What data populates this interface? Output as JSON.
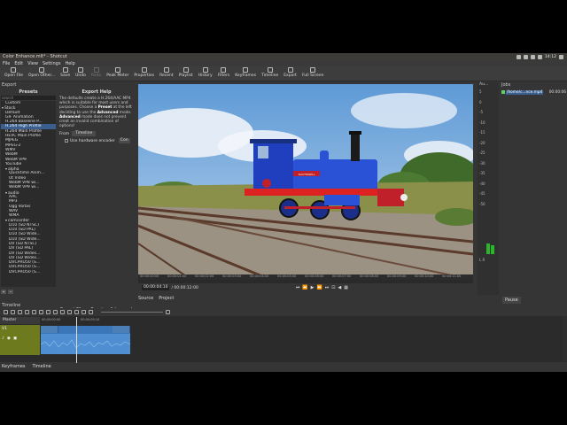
{
  "window": {
    "title": "Color Enhance.mlt* - Shotcut",
    "clock": "14:12"
  },
  "menu": [
    "File",
    "Edit",
    "View",
    "Settings",
    "Help"
  ],
  "toolbar": [
    {
      "label": "Open File",
      "icon": "folder-icon",
      "enabled": true
    },
    {
      "label": "Open Other...",
      "icon": "open-other-icon",
      "enabled": true
    },
    {
      "label": "Save",
      "icon": "save-icon",
      "enabled": true
    },
    {
      "label": "Undo",
      "icon": "undo-icon",
      "enabled": true
    },
    {
      "label": "Redo",
      "icon": "redo-icon",
      "enabled": false
    },
    {
      "label": "Peak Meter",
      "icon": "peak-meter-icon",
      "enabled": true
    },
    {
      "label": "Properties",
      "icon": "properties-icon",
      "enabled": true
    },
    {
      "label": "Recent",
      "icon": "recent-icon",
      "enabled": true
    },
    {
      "label": "Playlist",
      "icon": "playlist-icon",
      "enabled": true
    },
    {
      "label": "History",
      "icon": "history-icon",
      "enabled": true
    },
    {
      "label": "Filters",
      "icon": "filters-icon",
      "enabled": true
    },
    {
      "label": "Keyframes",
      "icon": "keyframes-icon",
      "enabled": true
    },
    {
      "label": "Timeline",
      "icon": "timeline-icon",
      "enabled": true
    },
    {
      "label": "Export",
      "icon": "export-icon",
      "enabled": true
    },
    {
      "label": "Full Screen",
      "icon": "fullscreen-icon",
      "enabled": true
    }
  ],
  "export": {
    "dock_title": "Export",
    "presets_header": "Presets",
    "search_placeholder": "search",
    "help_header": "Export Help",
    "help_text_1": "The defaults create a H.264/AAC MP4 which is suitable for most users and purposes. Choose a ",
    "help_bold_1": "Preset",
    "help_text_2": " at the left deciding to use the ",
    "help_bold_2": "Advanced",
    "help_text_3": " mode. ",
    "help_bold_3": "Advanced",
    "help_text_4": " mode does not prevent creat an invalid combination of options!",
    "from_label": "From",
    "from_value": "Timeline",
    "hw_label": "Use hardware encoder",
    "hw_config": "Con",
    "buttons": [
      "Export File",
      "Reset",
      "Advanced"
    ],
    "tree": [
      {
        "label": "Custom",
        "indent": 1,
        "cat": false
      },
      {
        "label": "Stock",
        "indent": 0,
        "cat": true
      },
      {
        "label": "Default",
        "indent": 1,
        "cat": false
      },
      {
        "label": "GIF Animation",
        "indent": 1,
        "cat": false
      },
      {
        "label": "H.264 Baseline P...",
        "indent": 1,
        "cat": false
      },
      {
        "label": "H.264 High Profile",
        "indent": 1,
        "cat": false,
        "selected": true
      },
      {
        "label": "H.264 Main Profile",
        "indent": 1,
        "cat": false
      },
      {
        "label": "HEVC Main Profile",
        "indent": 1,
        "cat": false
      },
      {
        "label": "MJPEG",
        "indent": 1,
        "cat": false
      },
      {
        "label": "MPEG-2",
        "indent": 1,
        "cat": false
      },
      {
        "label": "WMV",
        "indent": 1,
        "cat": false
      },
      {
        "label": "WebM",
        "indent": 1,
        "cat": false
      },
      {
        "label": "WebM VP9",
        "indent": 1,
        "cat": false
      },
      {
        "label": "YouTube",
        "indent": 1,
        "cat": false
      },
      {
        "label": "alpha",
        "indent": 1,
        "cat": true
      },
      {
        "label": "Quicktime Anim...",
        "indent": 2,
        "cat": false
      },
      {
        "label": "Ut Video",
        "indent": 2,
        "cat": false
      },
      {
        "label": "WebM VP8 wi...",
        "indent": 2,
        "cat": false
      },
      {
        "label": "WebM VP9 wi...",
        "indent": 2,
        "cat": false
      },
      {
        "label": "audio",
        "indent": 1,
        "cat": true
      },
      {
        "label": "AAC",
        "indent": 2,
        "cat": false
      },
      {
        "label": "MP3",
        "indent": 2,
        "cat": false
      },
      {
        "label": "Ogg Vorbis",
        "indent": 2,
        "cat": false
      },
      {
        "label": "WAV",
        "indent": 2,
        "cat": false
      },
      {
        "label": "WMA",
        "indent": 2,
        "cat": false
      },
      {
        "label": "camcorder",
        "indent": 1,
        "cat": true
      },
      {
        "label": "D10 (SD NTSC)",
        "indent": 2,
        "cat": false
      },
      {
        "label": "D10 (SD PAL)",
        "indent": 2,
        "cat": false
      },
      {
        "label": "D10 (SD Wide...",
        "indent": 2,
        "cat": false
      },
      {
        "label": "D10 (SD Wide...",
        "indent": 2,
        "cat": false
      },
      {
        "label": "DV (SD NTSC)",
        "indent": 2,
        "cat": false
      },
      {
        "label": "DV (SD PAL)",
        "indent": 2,
        "cat": false
      },
      {
        "label": "DV (SD Wides...",
        "indent": 2,
        "cat": false
      },
      {
        "label": "DV (SD Wides...",
        "indent": 2,
        "cat": false
      },
      {
        "label": "DVCPRO50 (S...",
        "indent": 2,
        "cat": false
      },
      {
        "label": "DVCPRO50 (S...",
        "indent": 2,
        "cat": false
      },
      {
        "label": "DVCPRO50 (S...",
        "indent": 2,
        "cat": false
      }
    ]
  },
  "left_tabs": [
    "Properties",
    "Playlist",
    "Filters",
    "Export"
  ],
  "viewer": {
    "timecode": "00:00:04:10",
    "duration": "/ 00:00:12:00",
    "ruler": [
      "00:00:00:00",
      "00:00:01:00",
      "00:00:02:00",
      "00:00:03:00",
      "00:00:04:00",
      "00:00:05:00",
      "00:00:06:00",
      "00:00:07:00",
      "00:00:08:00",
      "00:00:09:00",
      "00:00:10:00",
      "00:00:11:00"
    ],
    "tabs": [
      "Source",
      "Project"
    ],
    "locomotive_plate": "SOUTHWELL"
  },
  "meter": {
    "title": "Au...",
    "scale": [
      "5",
      "0",
      "-5",
      "-10",
      "-15",
      "-20",
      "-25",
      "-30",
      "-35",
      "-40",
      "-45",
      "-50"
    ],
    "lr": "L R"
  },
  "jobs": {
    "title": "Jobs",
    "job_name": "/home/c...nce.mp4",
    "job_time": "00:00:06",
    "pause": "Pause"
  },
  "timeline": {
    "title": "Timeline",
    "master": "Master",
    "track": "V1",
    "ruler": [
      "00:00:00:00",
      "00:00:05:10"
    ],
    "bottom_tabs": [
      "Keyframes",
      "Timeline"
    ]
  },
  "colors": {
    "accent": "#3a5f8f",
    "track_head": "#6e7a1e",
    "clip": "#3b77b8",
    "meter": "#2bb52b"
  }
}
